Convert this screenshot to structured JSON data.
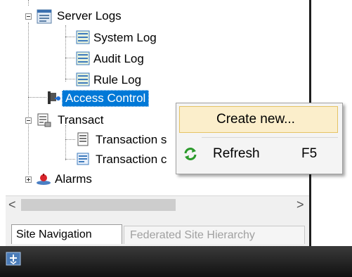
{
  "tree": {
    "server_logs": "Server Logs",
    "system_log": "System Log",
    "audit_log": "Audit Log",
    "rule_log": "Rule Log",
    "access_control": "Access Control",
    "transact": "Transact",
    "transaction_1": "Transaction s",
    "transaction_2": "Transaction c",
    "alarms": "Alarms"
  },
  "tabs": {
    "site_navigation": "Site Navigation",
    "federated_site_hierarchy": "Federated Site Hierarchy"
  },
  "context_menu": {
    "create_new": "Create new...",
    "refresh": "Refresh",
    "refresh_shortcut": "F5"
  },
  "scrollbar": {
    "left_arrow": "<",
    "right_arrow": ">"
  },
  "colors": {
    "selection": "#0078d7",
    "menu_highlight": "#fbeecb",
    "taskbar": "#1a1a1a"
  }
}
